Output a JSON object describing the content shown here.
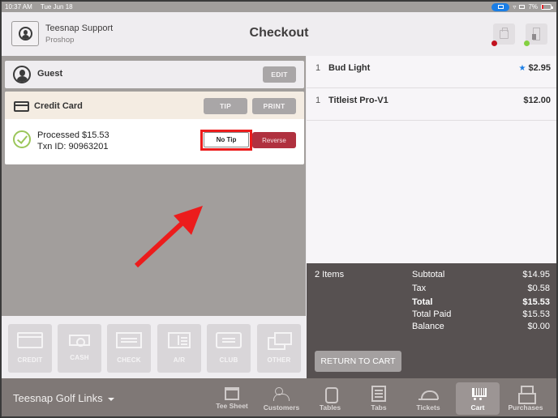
{
  "status_bar": {
    "time": "10:37 AM",
    "date": "Tue Jun 18",
    "battery": "7%",
    "icons": [
      "airplay-icon",
      "wifi-icon",
      "screen-mirror-icon",
      "battery-charging-icon"
    ]
  },
  "header": {
    "user_name": "Teesnap Support",
    "user_location": "Proshop",
    "title": "Checkout",
    "printer_status_color": "#c2121f",
    "drawer_status_color": "#84d041"
  },
  "guest": {
    "label": "Guest",
    "edit_label": "EDIT"
  },
  "payment": {
    "method_label": "Credit Card",
    "tip_label": "TIP",
    "print_label": "PRINT",
    "processed_text": "Processed $15.53",
    "txn_text": "Txn ID: 90963201",
    "no_tip_label": "No Tip",
    "reverse_label": "Reverse"
  },
  "tenders": [
    {
      "label": "CREDIT",
      "icon": "credit-card-icon"
    },
    {
      "label": "CASH",
      "icon": "cash-icon"
    },
    {
      "label": "CHECK",
      "icon": "check-icon"
    },
    {
      "label": "A/R",
      "icon": "accounts-receivable-icon"
    },
    {
      "label": "CLUB",
      "icon": "club-ticket-icon"
    },
    {
      "label": "OTHER",
      "icon": "other-payment-icon"
    }
  ],
  "cart": {
    "items": [
      {
        "qty": "1",
        "name": "Bud Light",
        "price": "$2.95",
        "starred": true
      },
      {
        "qty": "1",
        "name": "Titleist Pro-V1",
        "price": "$12.00",
        "starred": false
      }
    ],
    "summary": {
      "items_count": "2 Items",
      "rows": [
        {
          "label": "Subtotal",
          "value": "$14.95",
          "bold": false
        },
        {
          "label": "Tax",
          "value": "$0.58",
          "bold": false
        },
        {
          "label": "Total",
          "value": "$15.53",
          "bold": true
        },
        {
          "label": "Total Paid",
          "value": "$15.53",
          "bold": false
        },
        {
          "label": "Balance",
          "value": "$0.00",
          "bold": false
        }
      ],
      "return_label": "RETURN TO CART"
    }
  },
  "bottom_nav": {
    "venue": "Teesnap Golf Links",
    "items": [
      {
        "label": "Tee Sheet",
        "icon": "calendar-icon",
        "active": false
      },
      {
        "label": "Customers",
        "icon": "customers-icon",
        "active": false
      },
      {
        "label": "Tables",
        "icon": "tables-icon",
        "active": false
      },
      {
        "label": "Tabs",
        "icon": "tabs-icon",
        "active": false
      },
      {
        "label": "Tickets",
        "icon": "cloche-icon",
        "active": false
      },
      {
        "label": "Cart",
        "icon": "cart-icon",
        "active": true
      },
      {
        "label": "Purchases",
        "icon": "cash-register-icon",
        "active": false
      }
    ]
  },
  "annotation": {
    "highlight_color": "#ec1c1c",
    "target": "No Tip"
  }
}
